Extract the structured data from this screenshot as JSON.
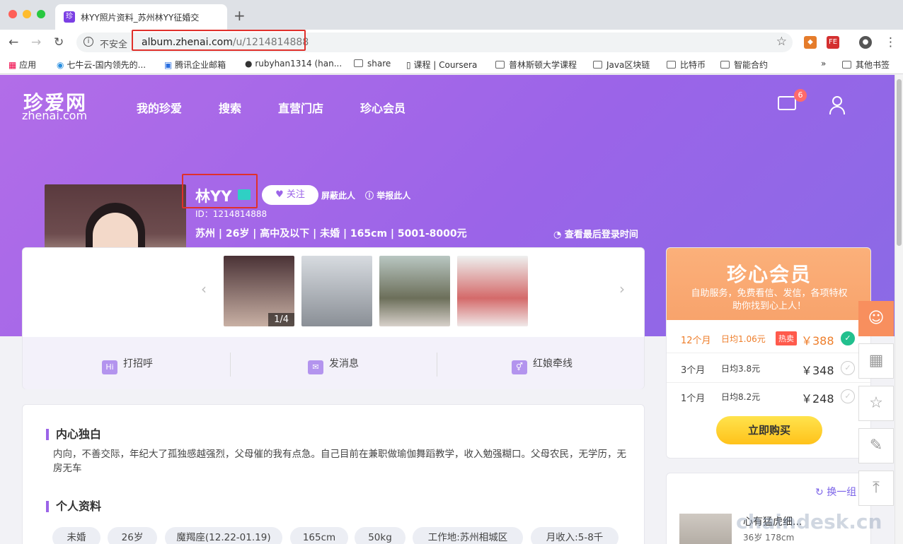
{
  "browser": {
    "tab_title": "林YY照片资料_苏州林YY征婚交",
    "tab_icon": "珍",
    "new_tab": "+",
    "insecure": "不安全",
    "url_host": "album.zhenai.com",
    "url_path": "/u/1214814888"
  },
  "bookmarks": [
    "应用",
    "七牛云-国内领先的...",
    "腾讯企业邮箱",
    "rubyhan1314 (han...",
    "share",
    "课程 | Coursera",
    "普林斯顿大学课程",
    "Java区块链",
    "比特币",
    "智能合约",
    "»",
    "其他书签"
  ],
  "header": {
    "logo_cn": "珍爱网",
    "logo_en": "zhenai.com",
    "nav": [
      "我的珍爱",
      "搜索",
      "直营门店",
      "珍心会员"
    ],
    "message_count": "6"
  },
  "profile": {
    "name": "林YY",
    "follow_label": "关注",
    "block_label": "屏蔽此人",
    "report_label": "举报此人",
    "id_text": "ID：1214814888",
    "summary": "苏州 | 26岁 | 高中及以下 | 未婚 | 165cm | 5001-8000元",
    "last_login": "查看最后登录时间",
    "photo_counter": "1/4"
  },
  "actions": [
    {
      "icon": "Hi",
      "label": "打招呼"
    },
    {
      "icon": "✉",
      "label": "发消息"
    },
    {
      "icon": "⚥",
      "label": "红娘牵线"
    }
  ],
  "about": {
    "title": "内心独白",
    "text": "内向，不善交际，年纪大了孤独感越强烈，父母催的我有点急。自己目前在兼职做瑜伽舞蹈教学，收入勉强糊口。父母农民，无学历，无房无车",
    "info_title": "个人资料",
    "tags": [
      "未婚",
      "26岁",
      "魔羯座(12.22-01.19)",
      "165cm",
      "50kg",
      "工作地:苏州相城区",
      "月收入:5-8千"
    ]
  },
  "vip": {
    "title": "珍心会员",
    "subtitle_1": "自助服务，免费看信、发信，各项特权",
    "subtitle_2": "助你找到心上人！",
    "plans": [
      {
        "months": "12个月",
        "daily": "日均1.06元",
        "hot": "热卖",
        "price": "￥388"
      },
      {
        "months": "3个月",
        "daily": "日均3.8元",
        "hot": "",
        "price": "￥348"
      },
      {
        "months": "1个月",
        "daily": "日均8.2元",
        "hot": "",
        "price": "￥248"
      }
    ],
    "buy_label": "立即购买"
  },
  "recommend": {
    "refresh_label": "换一组",
    "name": "心有猛虎细...",
    "meta": "36岁  178cm"
  },
  "watermark": "chaindesk.cn",
  "colors": {
    "hero": "#9b64e8",
    "accent": "#7b63e8",
    "buy": "#ffc21a",
    "vip_head": "#f8a36c"
  }
}
